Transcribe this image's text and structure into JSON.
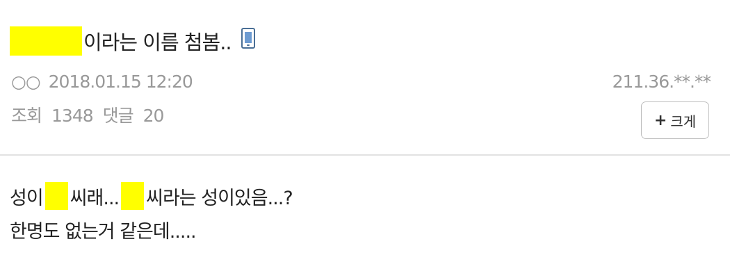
{
  "post": {
    "title": "이라는 이름 첨봄..",
    "author_masked": "○○",
    "datetime": "2018.01.15 12:20",
    "ip": "211.36.**.**",
    "views_label": "조회",
    "views": "1348",
    "comments_label": "댓글",
    "comments": "20",
    "zoom_button_label": "크게",
    "body": {
      "line1_part1": "성이",
      "line1_part2": "씨래...",
      "line1_part3": "씨라는 성이있음...?",
      "line2": "한명도 없는거 같은데....."
    }
  },
  "colors": {
    "redaction": "#ffff00",
    "meta_text": "#999999",
    "divider": "#e2e2e2"
  },
  "icons": {
    "mobile": "mobile-phone-icon",
    "plus": "plus-icon"
  }
}
